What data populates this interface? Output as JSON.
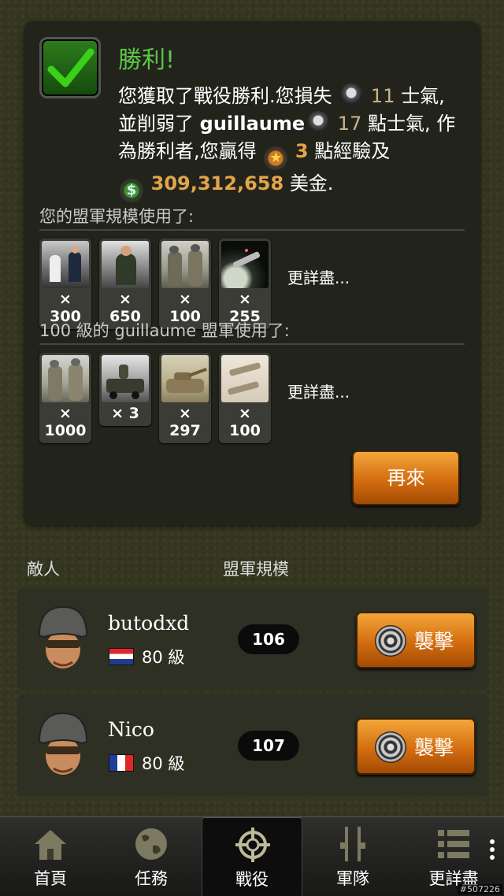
{
  "result": {
    "title": "勝利!",
    "line1_a": "您獲取了戰役勝利.您損失",
    "line1_num": "11",
    "line1_b": "士氣,",
    "line2_a": "並削弱了",
    "line2_name": "guillaume",
    "line2_num": "17",
    "line2_b": "點士氣, 作",
    "line3_a": "為勝利者,您贏得",
    "line3_num": "3",
    "line3_b": "點經驗及",
    "line4_num": "309,312,658",
    "line4_b": "美金.",
    "money_symbol": "$",
    "star_symbol": "★"
  },
  "your_army": {
    "label": "您的盟軍規模使用了:",
    "units": [
      {
        "icon": "navy-officers-icon",
        "count": "× 300"
      },
      {
        "icon": "general-officer-icon",
        "count": "× 650"
      },
      {
        "icon": "soldiers-icon",
        "count": "× 100"
      },
      {
        "icon": "spacecraft-icon",
        "count": "× 255"
      }
    ],
    "more": "更詳盡..."
  },
  "enemy_army": {
    "label": "100 級的 guillaume 盟軍使用了:",
    "units": [
      {
        "icon": "soldiers-icon",
        "count": "× 1000"
      },
      {
        "icon": "armed-vehicle-icon",
        "count": "× 3"
      },
      {
        "icon": "tank-icon",
        "count": "× 297"
      },
      {
        "icon": "fighter-jet-icon",
        "count": "× 100"
      }
    ],
    "more": "更詳盡..."
  },
  "again_label": "再來",
  "list": {
    "col_enemy": "敵人",
    "col_size": "盟軍規模",
    "enemies": [
      {
        "name": "butodxd",
        "flag": "croatia-flag",
        "level": "80 級",
        "size": "106",
        "attack": "襲擊"
      },
      {
        "name": "Nico",
        "flag": "france-flag",
        "level": "80 級",
        "size": "107",
        "attack": "襲擊"
      }
    ]
  },
  "nav": [
    {
      "label": "首頁",
      "icon": "home-icon"
    },
    {
      "label": "任務",
      "icon": "globe-icon"
    },
    {
      "label": "戰役",
      "icon": "crosshair-icon",
      "active": true
    },
    {
      "label": "軍隊",
      "icon": "rifles-icon"
    },
    {
      "label": "更詳盡",
      "icon": "list-icon"
    }
  ],
  "corner_tag": "#507226",
  "colors": {
    "accent_green": "#5cc646",
    "button_orange": "#e08a24",
    "highlight_num": "#e3a54a"
  }
}
